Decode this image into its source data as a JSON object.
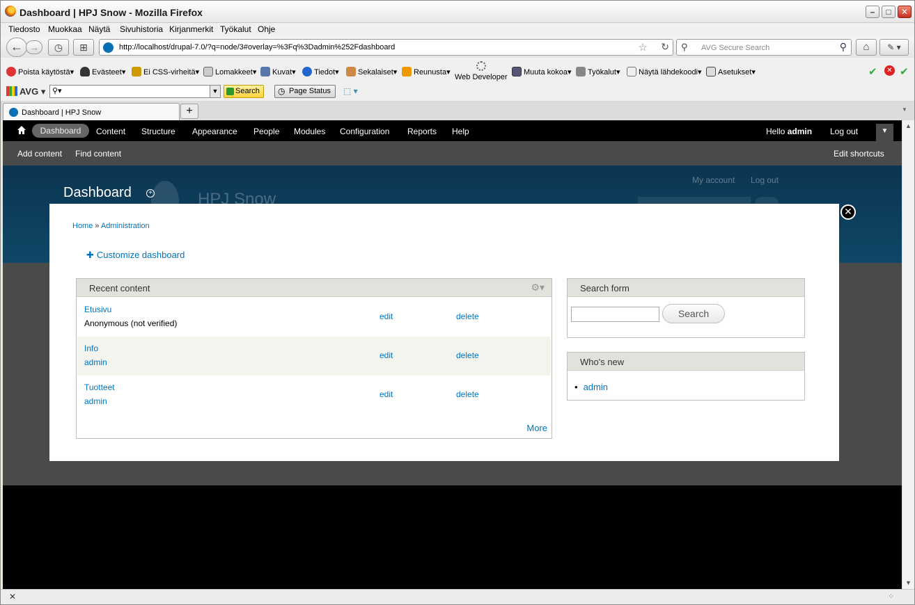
{
  "window": {
    "title": "Dashboard | HPJ Snow - Mozilla Firefox"
  },
  "menu": [
    "Tiedosto",
    "Muokkaa",
    "Näytä",
    "Sivuhistoria",
    "Kirjanmerkit",
    "Työkalut",
    "Ohje"
  ],
  "nav": {
    "url": "http://localhost/drupal-7.0/?q=node/3#overlay=%3Fq%3Dadmin%252Fdashboard",
    "search_placeholder": "AVG Secure Search"
  },
  "webdev_toolbar": {
    "items": [
      "Poista käytöstä",
      "Evästeet",
      "Ei CSS-virheitä",
      "Lomakkeet",
      "Kuvat",
      "Tiedot",
      "Sekalaiset",
      "Reunusta",
      "Web Developer",
      "Muuta kokoa",
      "Työkalut",
      "Näytä lähdekoodi",
      "Asetukset"
    ]
  },
  "avg_toolbar": {
    "logo": "AVG",
    "search_label": "Search",
    "page_status_label": "Page Status"
  },
  "tab": {
    "label": "Dashboard | HPJ Snow"
  },
  "admin_toolbar": {
    "items": [
      "Dashboard",
      "Content",
      "Structure",
      "Appearance",
      "People",
      "Modules",
      "Configuration",
      "Reports",
      "Help"
    ],
    "hello": "Hello",
    "user": "admin",
    "logout": "Log out",
    "shortcuts": [
      "Add content",
      "Find content"
    ],
    "edit_shortcuts": "Edit shortcuts"
  },
  "theme": {
    "page_title": "Dashboard",
    "site_name": "HPJ Snow",
    "secondary": [
      "My account",
      "Log out"
    ]
  },
  "overlay": {
    "breadcrumb": [
      "Home",
      "Administration"
    ],
    "customize": "Customize dashboard",
    "recent_content": {
      "title": "Recent content",
      "rows": [
        {
          "title": "Etusivu",
          "author": "Anonymous (not verified)",
          "edit": "edit",
          "delete": "delete"
        },
        {
          "title": "Info",
          "author": "admin",
          "edit": "edit",
          "delete": "delete"
        },
        {
          "title": "Tuotteet",
          "author": "admin",
          "edit": "edit",
          "delete": "delete"
        }
      ],
      "more": "More"
    },
    "search_form": {
      "title": "Search form",
      "button": "Search"
    },
    "whos_new": {
      "title": "Who's new",
      "items": [
        "admin"
      ]
    }
  },
  "colors": {
    "link": "#0074bd",
    "toolbar": "#000000",
    "shortcut_bar": "#4a4a4a",
    "header": "#0b3552"
  }
}
